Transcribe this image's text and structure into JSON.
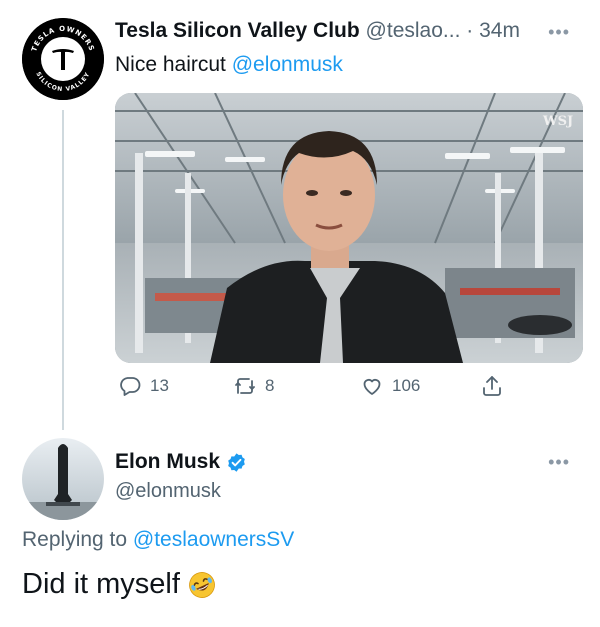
{
  "tweet": {
    "author_name": "Tesla Silicon Valley Club",
    "author_handle": "@teslao...",
    "separator": "·",
    "time": "34m",
    "text": "Nice haircut ",
    "mention": "@elonmusk",
    "avatar_label_top": "TESLA OWNERS",
    "avatar_label_bottom": "SILICON VALLEY",
    "media_watermark": "WSJ",
    "stats": {
      "replies": "13",
      "retweets": "8",
      "likes": "106"
    }
  },
  "reply": {
    "author_name": "Elon Musk",
    "author_handle": "@elonmusk",
    "replying_prefix": "Replying to ",
    "replying_handle": "@teslaownersSV",
    "text": "Did it myself",
    "emoji": "rolling-on-floor-laughing"
  },
  "icons": [
    "reply-icon",
    "retweet-icon",
    "like-icon",
    "share-icon",
    "verified-badge-icon",
    "more-icon"
  ],
  "colors": {
    "accent": "#1d9bf0",
    "secondary_text": "#536471",
    "thread_line": "#cfd9de"
  }
}
